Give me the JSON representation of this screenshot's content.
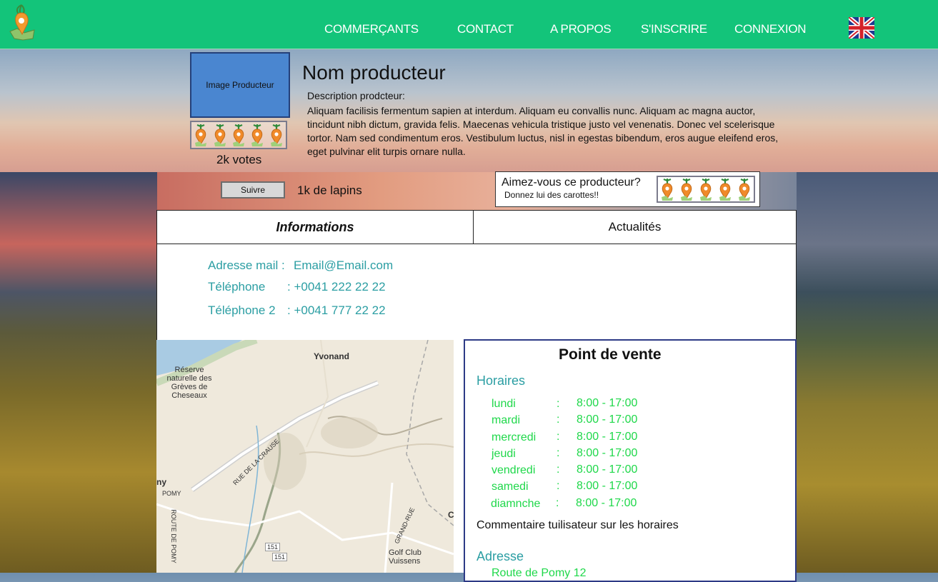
{
  "nav": {
    "items": [
      "COMMERÇANTS",
      "CONTACT",
      "A PROPOS",
      "S'INSCRIRE",
      "CONNEXION"
    ]
  },
  "producer": {
    "image_placeholder": "Image Producteur",
    "name": "Nom producteur",
    "description_label": "Description prodcteur:",
    "description": "Aliquam facilisis fermentum sapien at interdum. Aliquam eu convallis nunc. Aliquam ac magna auctor, tincidunt nibh dictum, gravida felis. Maecenas vehicula tristique justo vel venenatis. Donec vel scelerisque tortor. Nam sed condimentum eros. Vestibulum luctus, nisl in egestas bibendum, eros augue eleifend eros, eget pulvinar elit turpis ornare nulla.",
    "votes": "2k votes",
    "rating": 5,
    "follow_button": "Suivre",
    "followers": "1k de lapins"
  },
  "like_box": {
    "title": "Aimez-vous ce producteur?",
    "subtitle": "Donnez lui des carottes!!",
    "rating": 5
  },
  "tabs": {
    "info": "Informations",
    "news": "Actualités"
  },
  "info": {
    "email_label": "Adresse mail :",
    "email_value": "Email@Email.com",
    "phone_label": "Téléphone",
    "phone_value": ": +0041 222 22 22",
    "phone2_label": "Téléphone 2",
    "phone2_value": ": +0041 777 22 22"
  },
  "map": {
    "labels": [
      "Yvonand",
      "Réserve naturelle des Grèves de Cheseaux",
      "RUE DE LA CRAUSE",
      "POMY",
      "ROUTE DE POMY",
      "GRAND-RUE",
      "Golf Club Vuissens",
      "151",
      "151",
      "ny",
      "C"
    ]
  },
  "point_de_vente": {
    "title": "Point de vente",
    "hours_heading": "Horaires",
    "days": [
      {
        "day": "lundi",
        "hours": "8:00 - 17:00"
      },
      {
        "day": "mardi",
        "hours": "8:00 - 17:00"
      },
      {
        "day": "mercredi",
        "hours": "8:00 - 17:00"
      },
      {
        "day": "jeudi",
        "hours": "8:00 - 17:00"
      },
      {
        "day": "vendredi",
        "hours": "8:00 - 17:00"
      },
      {
        "day": "samedi",
        "hours": "8:00 - 17:00"
      },
      {
        "day": "diamnche",
        "hours": "8:00 - 17:00"
      }
    ],
    "colon": ":",
    "comment": "Commentaire tuilisateur sur les horaires",
    "address_heading": "Adresse",
    "address_line": "Route de Pomy 12"
  },
  "colors": {
    "topbar": "#13c47a",
    "accent_text": "#2b9ea3",
    "hours_text": "#1fd84a",
    "producer_image": "#4a86d0"
  }
}
